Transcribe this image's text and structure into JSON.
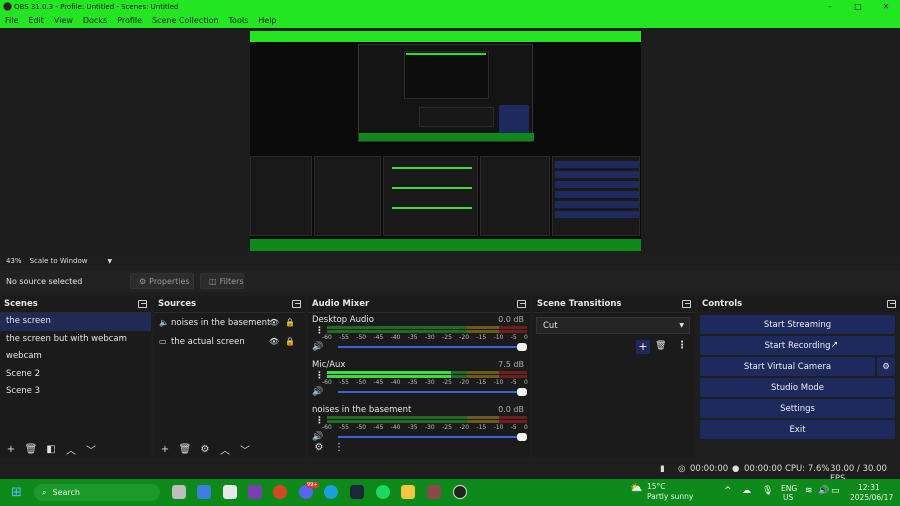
{
  "window": {
    "title": "OBS 31.0.3 - Profile: Untitled - Scenes: Untitled",
    "controls": [
      "–",
      "□",
      "✕"
    ]
  },
  "menu": [
    "File",
    "Edit",
    "View",
    "Docks",
    "Profile",
    "Scene Collection",
    "Tools",
    "Help"
  ],
  "zoom": {
    "percent": "43%",
    "mode": "Scale to Window"
  },
  "source_bar": {
    "status": "No source selected",
    "properties": "Properties",
    "filters": "Filters"
  },
  "scenes": {
    "title": "Scenes",
    "items": [
      "the screen",
      "the screen but with webcam",
      "webcam",
      "Scene 2",
      "Scene 3"
    ],
    "selected": 0
  },
  "sources": {
    "title": "Sources",
    "items": [
      {
        "name": "noises in the basement",
        "icon": "speaker-icon"
      },
      {
        "name": "the actual screen",
        "icon": "monitor-icon"
      }
    ]
  },
  "mixer": {
    "title": "Audio Mixer",
    "ticks": [
      "-60",
      "-55",
      "-50",
      "-45",
      "-40",
      "-35",
      "-30",
      "-25",
      "-20",
      "-15",
      "-10",
      "-5",
      "0"
    ],
    "channels": [
      {
        "name": "Desktop Audio",
        "db": "0.0 dB",
        "level": 0.0
      },
      {
        "name": "Mic/Aux",
        "db": "7.5 dB",
        "level": 0.62
      },
      {
        "name": "noises in the basement",
        "db": "0.0 dB",
        "level": 0.0
      }
    ]
  },
  "transitions": {
    "title": "Scene Transitions",
    "selected": "Cut"
  },
  "controls": {
    "title": "Controls",
    "start_streaming": "Start Streaming",
    "start_recording": "Start Recording",
    "start_virtual_camera": "Start Virtual Camera",
    "studio_mode": "Studio Mode",
    "settings": "Settings",
    "exit": "Exit"
  },
  "status": {
    "stream_time": "00:00:00",
    "record_time": "00:00:00",
    "cpu": "CPU: 7.6%",
    "fps": "30.00 / 30.00 FPS"
  },
  "taskbar": {
    "search": "Search",
    "weather_temp": "15°C",
    "weather_text": "Partly sunny",
    "lang_1": "ENG",
    "lang_2": "US",
    "time": "12:31",
    "date": "2025/06/17",
    "notification_badge": "99+"
  },
  "colors": {
    "accent_green": "#21e621",
    "taskbar_green": "#0e8a1a",
    "button_blue": "#1e2a5e",
    "fader_blue": "#3d63d8"
  }
}
